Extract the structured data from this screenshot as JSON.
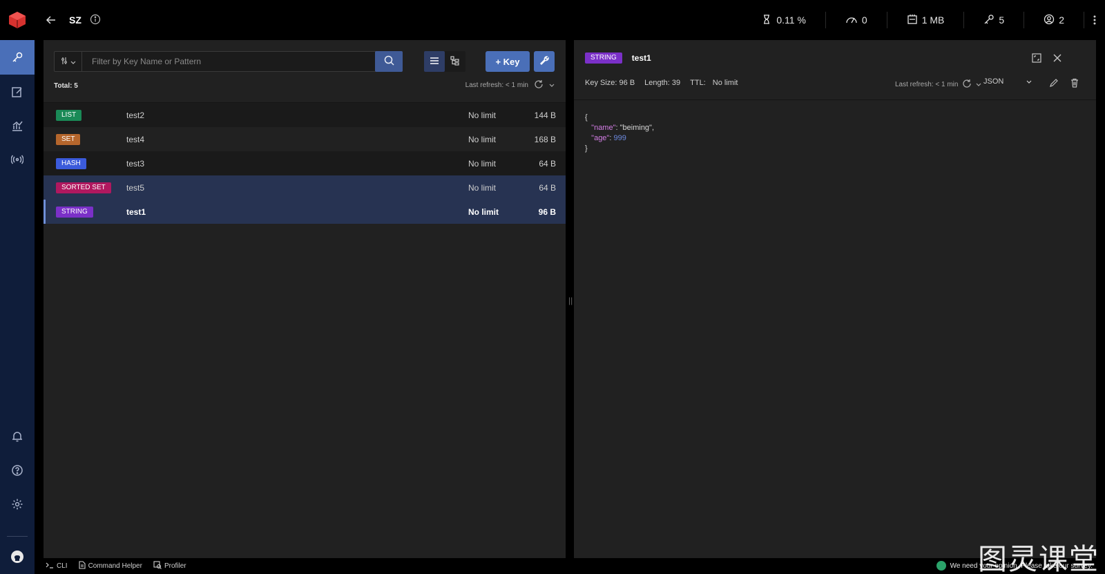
{
  "topbar": {
    "db_name": "SZ",
    "stats": [
      {
        "icon": "cpu-icon",
        "value": "0.11 %"
      },
      {
        "icon": "speedometer-icon",
        "value": "0"
      },
      {
        "icon": "memory-icon",
        "value": "1 MB"
      },
      {
        "icon": "key-icon",
        "value": "5"
      },
      {
        "icon": "user-icon",
        "value": "2"
      }
    ]
  },
  "list": {
    "filter_placeholder": "Filter by Key Name or Pattern",
    "add_key_label": "+ Key",
    "total": "Total: 5",
    "last_refresh": "Last refresh: < 1 min",
    "rows": [
      {
        "type": "LIST",
        "name": "test2",
        "ttl": "No limit",
        "size": "144 B"
      },
      {
        "type": "SET",
        "name": "test4",
        "ttl": "No limit",
        "size": "168 B"
      },
      {
        "type": "HASH",
        "name": "test3",
        "ttl": "No limit",
        "size": "64 B"
      },
      {
        "type": "SORTED SET",
        "name": "test5",
        "ttl": "No limit",
        "size": "64 B"
      },
      {
        "type": "STRING",
        "name": "test1",
        "ttl": "No limit",
        "size": "96 B"
      }
    ]
  },
  "detail": {
    "type": "STRING",
    "key_name": "test1",
    "key_size": "Key Size: 96 B",
    "length": "Length: 39",
    "ttl_label": "TTL:",
    "ttl_value": "No limit",
    "last_refresh": "Last refresh: < 1 min",
    "format": "JSON",
    "json": {
      "open": "{",
      "name_key": "\"name\"",
      "name_val": "\"beiming\",",
      "age_key": "\"age\"",
      "age_val": "999",
      "close": "}"
    }
  },
  "bottombar": {
    "cli": "CLI",
    "command_helper": "Command Helper",
    "profiler": "Profiler",
    "survey": "We need your opinion. Please take our survey."
  },
  "watermark": "图灵课堂",
  "colors": {
    "LIST": "#1a8a57",
    "SET": "#b5662c",
    "HASH": "#3b5bdb",
    "SORTED SET": "#b0185f",
    "STRING": "#7b30c8",
    "accent": "#4a6fb8"
  }
}
